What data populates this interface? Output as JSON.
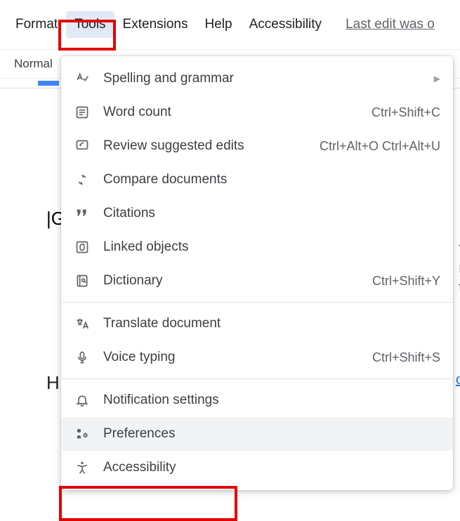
{
  "menubar": {
    "items": [
      "Format",
      "Tools",
      "Extensions",
      "Help",
      "Accessibility"
    ],
    "last_edit": "Last edit was o"
  },
  "toolbar": {
    "style": "Normal"
  },
  "doc": {
    "line1": "|G",
    "line2": "H"
  },
  "dropdown": {
    "groups": [
      [
        {
          "icon": "spellcheck",
          "label": "Spelling and grammar",
          "shortcut": "",
          "submenu": true
        },
        {
          "icon": "wordcount",
          "label": "Word count",
          "shortcut": "Ctrl+Shift+C"
        },
        {
          "icon": "review",
          "label": "Review suggested edits",
          "shortcut": "Ctrl+Alt+O Ctrl+Alt+U"
        },
        {
          "icon": "compare",
          "label": "Compare documents",
          "shortcut": ""
        },
        {
          "icon": "quote",
          "label": "Citations",
          "shortcut": ""
        },
        {
          "icon": "link",
          "label": "Linked objects",
          "shortcut": ""
        },
        {
          "icon": "dictionary",
          "label": "Dictionary",
          "shortcut": "Ctrl+Shift+Y"
        }
      ],
      [
        {
          "icon": "translate",
          "label": "Translate document",
          "shortcut": ""
        },
        {
          "icon": "mic",
          "label": "Voice typing",
          "shortcut": "Ctrl+Shift+S"
        }
      ],
      [
        {
          "icon": "bell",
          "label": "Notification settings",
          "shortcut": ""
        },
        {
          "icon": "prefs",
          "label": "Preferences",
          "shortcut": "",
          "hovered": true
        },
        {
          "icon": "accessibility",
          "label": "Accessibility",
          "shortcut": ""
        }
      ]
    ]
  },
  "bg": {
    "r1": "f",
    "r2": "r",
    "r3": "t",
    "link": "o"
  }
}
